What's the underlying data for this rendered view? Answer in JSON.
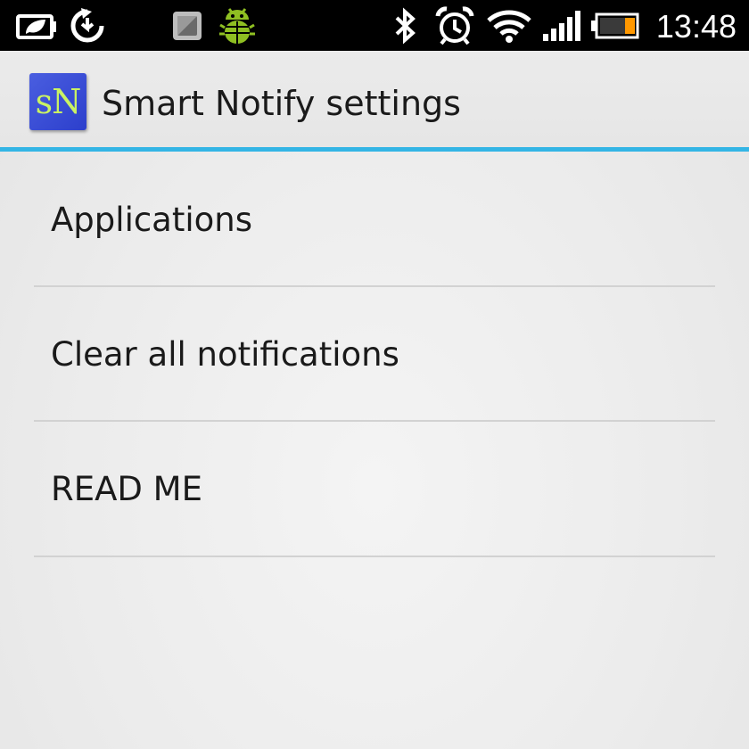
{
  "status_bar": {
    "time": "13:48",
    "icons_left": [
      "battery-saver-icon",
      "sync-icon",
      "screen-icon",
      "android-debug-icon"
    ],
    "icons_right": [
      "bluetooth-icon",
      "alarm-icon",
      "wifi-icon",
      "signal-icon",
      "battery-icon"
    ]
  },
  "action_bar": {
    "icon_text": "sN",
    "title": "Smart Notify settings",
    "accent_color": "#33b5e5"
  },
  "list": {
    "items": [
      {
        "label": "Applications"
      },
      {
        "label": "Clear all notifications"
      },
      {
        "label": "READ ME"
      }
    ]
  }
}
